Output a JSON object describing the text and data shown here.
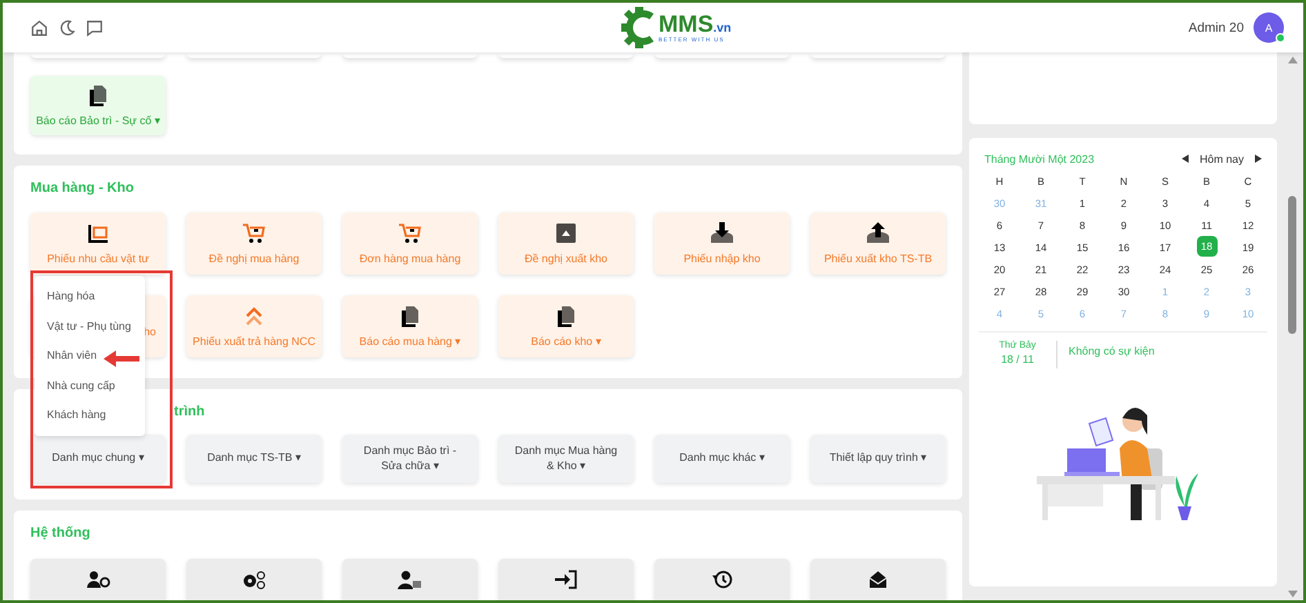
{
  "header": {
    "logo": {
      "text": "MMS",
      "suffix": ".vn",
      "tagline": "BETTER WITH US"
    },
    "user": {
      "name": "Admin 20",
      "initial": "A",
      "online": true
    }
  },
  "sections": [
    {
      "kind": "report",
      "tiles": [
        {
          "label": "Báo cáo Bảo trì - Sự cố ▾",
          "kind": "tile"
        }
      ]
    },
    {
      "kind": "tiles",
      "title": "Mua hàng - Kho",
      "tiles": [
        {
          "label": "Phiếu nhu cầu vật tư",
          "kind": "tile"
        },
        {
          "label": "Đề nghị mua hàng",
          "kind": "tile"
        },
        {
          "label": "Đơn hàng mua hàng",
          "kind": "tile"
        },
        {
          "label": "Đề nghị xuất kho",
          "kind": "tile"
        },
        {
          "label": "Phiếu nhập kho",
          "kind": "tile"
        },
        {
          "label": "Phiếu xuất kho TS-TB",
          "kind": "tile"
        },
        {
          "label": "ho",
          "kind": "covered"
        },
        {
          "label": "Phiếu xuất trả hàng NCC",
          "kind": "tile"
        },
        {
          "label": "Báo cáo mua hàng ▾",
          "kind": "tile"
        },
        {
          "label": "Báo cáo kho ▾",
          "kind": "tile"
        }
      ]
    },
    {
      "kind": "buttons",
      "title": "trình",
      "tiles": [
        {
          "label": "Danh mục chung ▾",
          "kind": "tile",
          "menu": [
            "Hàng hóa",
            "Vật tư - Phụ tùng",
            "Nhân viên",
            "Nhà cung cấp",
            "Khách hàng"
          ]
        },
        {
          "label": "Danh mục TS-TB ▾",
          "kind": "tile"
        },
        {
          "label": "Danh mục Bảo trì - Sửa chữa ▾",
          "kind": "tile"
        },
        {
          "label": "Danh mục Mua hàng & Kho ▾",
          "kind": "tile"
        },
        {
          "label": "Danh mục khác ▾",
          "kind": "tile"
        },
        {
          "label": "Thiết lập quy trình ▾",
          "kind": "tile"
        }
      ]
    },
    {
      "kind": "icons",
      "title": "Hệ thống",
      "tiles": [
        {
          "kind": "tile"
        },
        {
          "kind": "tile"
        },
        {
          "kind": "tile"
        },
        {
          "kind": "tile"
        },
        {
          "kind": "tile"
        },
        {
          "kind": "tile"
        }
      ]
    }
  ],
  "calendar": {
    "month": "Tháng Mười Một 2023",
    "today_button": "Hôm nay",
    "weekdays": [
      "H",
      "B",
      "T",
      "N",
      "S",
      "B",
      "C"
    ],
    "weeks": [
      [
        {
          "day": "30",
          "muted": true,
          "selected": false
        },
        {
          "day": "31",
          "muted": true,
          "selected": false
        },
        {
          "day": "1",
          "muted": false,
          "selected": false
        },
        {
          "day": "2",
          "muted": false,
          "selected": false
        },
        {
          "day": "3",
          "muted": false,
          "selected": false
        },
        {
          "day": "4",
          "muted": false,
          "selected": false
        },
        {
          "day": "5",
          "muted": false,
          "selected": false
        }
      ],
      [
        {
          "day": "6",
          "muted": false,
          "selected": false
        },
        {
          "day": "7",
          "muted": false,
          "selected": false
        },
        {
          "day": "8",
          "muted": false,
          "selected": false
        },
        {
          "day": "9",
          "muted": false,
          "selected": false
        },
        {
          "day": "10",
          "muted": false,
          "selected": false
        },
        {
          "day": "11",
          "muted": false,
          "selected": false
        },
        {
          "day": "12",
          "muted": false,
          "selected": false
        }
      ],
      [
        {
          "day": "13",
          "muted": false,
          "selected": false
        },
        {
          "day": "14",
          "muted": false,
          "selected": false
        },
        {
          "day": "15",
          "muted": false,
          "selected": false
        },
        {
          "day": "16",
          "muted": false,
          "selected": false
        },
        {
          "day": "17",
          "muted": false,
          "selected": false
        },
        {
          "day": "18",
          "muted": false,
          "selected": true
        },
        {
          "day": "19",
          "muted": false,
          "selected": false
        }
      ],
      [
        {
          "day": "20",
          "muted": false,
          "selected": false
        },
        {
          "day": "21",
          "muted": false,
          "selected": false
        },
        {
          "day": "22",
          "muted": false,
          "selected": false
        },
        {
          "day": "23",
          "muted": false,
          "selected": false
        },
        {
          "day": "24",
          "muted": false,
          "selected": false
        },
        {
          "day": "25",
          "muted": false,
          "selected": false
        },
        {
          "day": "26",
          "muted": false,
          "selected": false
        }
      ],
      [
        {
          "day": "27",
          "muted": false,
          "selected": false
        },
        {
          "day": "28",
          "muted": false,
          "selected": false
        },
        {
          "day": "29",
          "muted": false,
          "selected": false
        },
        {
          "day": "30",
          "muted": false,
          "selected": false
        },
        {
          "day": "1",
          "muted": true,
          "selected": false
        },
        {
          "day": "2",
          "muted": true,
          "selected": false
        },
        {
          "day": "3",
          "muted": true,
          "selected": false
        }
      ],
      [
        {
          "day": "4",
          "muted": true,
          "selected": false
        },
        {
          "day": "5",
          "muted": true,
          "selected": false
        },
        {
          "day": "6",
          "muted": true,
          "selected": false
        },
        {
          "day": "7",
          "muted": true,
          "selected": false
        },
        {
          "day": "8",
          "muted": true,
          "selected": false
        },
        {
          "day": "9",
          "muted": true,
          "selected": false
        },
        {
          "day": "10",
          "muted": true,
          "selected": false
        }
      ]
    ],
    "event_weekday": "Thứ Bảy",
    "event_date": "18 / 11",
    "event_text": "Không có sự kiện"
  }
}
